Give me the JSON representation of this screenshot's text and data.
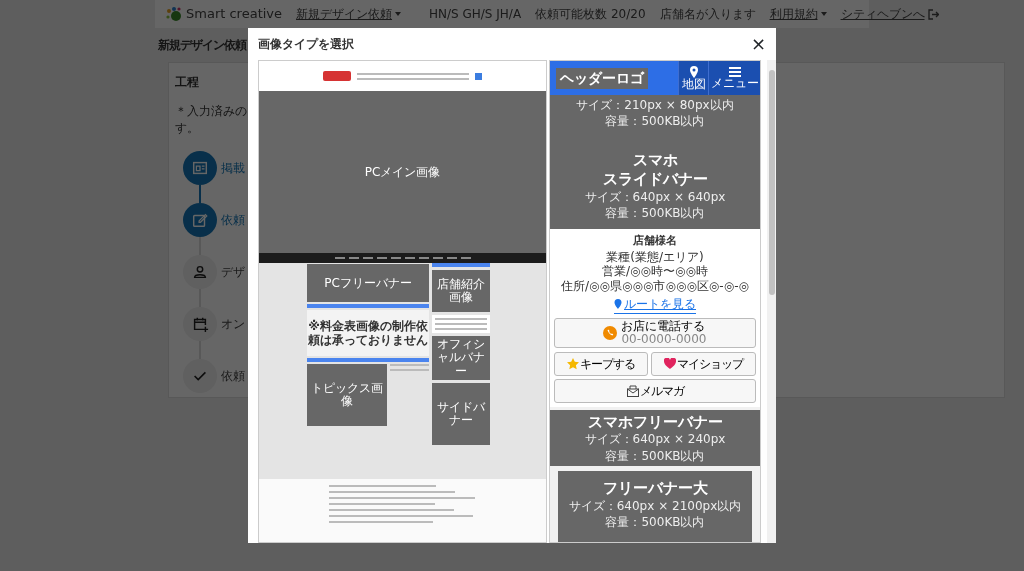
{
  "navbar": {
    "brand": "Smart creative",
    "items": [
      {
        "label": "新規デザイン依頼",
        "kind": "dropdown"
      }
    ],
    "right_items": [
      {
        "label": "HN/S GH/S JH/A",
        "kind": "text"
      },
      {
        "label": "依頼可能枚数 20/20",
        "kind": "text"
      },
      {
        "label": "店舗名が入ります",
        "kind": "text"
      },
      {
        "label": "利用規約",
        "kind": "dropdown"
      },
      {
        "label": "シティヘブンへ",
        "kind": "logout"
      }
    ]
  },
  "page": {
    "title": "新規デザイン依頼",
    "card": {
      "title": "工程",
      "note_lines": [
        "＊入力済みの",
        "す。"
      ],
      "steps": [
        {
          "label": "掲載",
          "completed": true
        },
        {
          "label": "依頼",
          "completed": true
        },
        {
          "label": "デザ",
          "completed": false
        },
        {
          "label": "オン",
          "completed": false
        },
        {
          "label": "依頼",
          "completed": false
        }
      ]
    }
  },
  "modal": {
    "title": "画像タイプを選択",
    "close": "×",
    "pc_preview": {
      "main_image": "PCメイン画像",
      "free_banner": "PCフリーバナー",
      "notice": "※料金表画像の制作依頼は承っておりません",
      "topics": "トピックス画像",
      "shop_intro": "店舗紹介画像",
      "official_banner": "オフィシャルバナー",
      "side_banner": "サイドバナー"
    },
    "sp_preview": {
      "header_logo": "ヘッダーロゴ",
      "map": "地図",
      "menu": "メニュー",
      "logo_size": "サイズ：210px × 80px以内",
      "logo_capacity": "容量：500KB以内",
      "slide_banner": {
        "title_lines": [
          "スマホ",
          "スライドバナー"
        ],
        "size": "サイズ：640px × 640px",
        "capacity": "容量：500KB以内"
      },
      "shop": {
        "name": "店舗様名",
        "category": "業種(業態/エリア)",
        "hours": "営業/◎◎時〜◎◎時",
        "address": "住所/◎◎県◎◎◎市◎◎◎区◎-◎-◎",
        "route": "ルートを見る"
      },
      "call": {
        "label": "お店に電話する",
        "number": "00-0000-0000"
      },
      "actions": [
        {
          "label": "キープする"
        },
        {
          "label": "マイショップ"
        },
        {
          "label": "メルマガ"
        }
      ],
      "free_banner": {
        "title": "スマホフリーバナー",
        "size": "サイズ：640px × 240px",
        "capacity": "容量：500KB以内"
      },
      "large_banner": {
        "title": "フリーバナー大",
        "size": "サイズ：640px × 2100px以内",
        "capacity": "容量：500KB以内"
      }
    }
  }
}
